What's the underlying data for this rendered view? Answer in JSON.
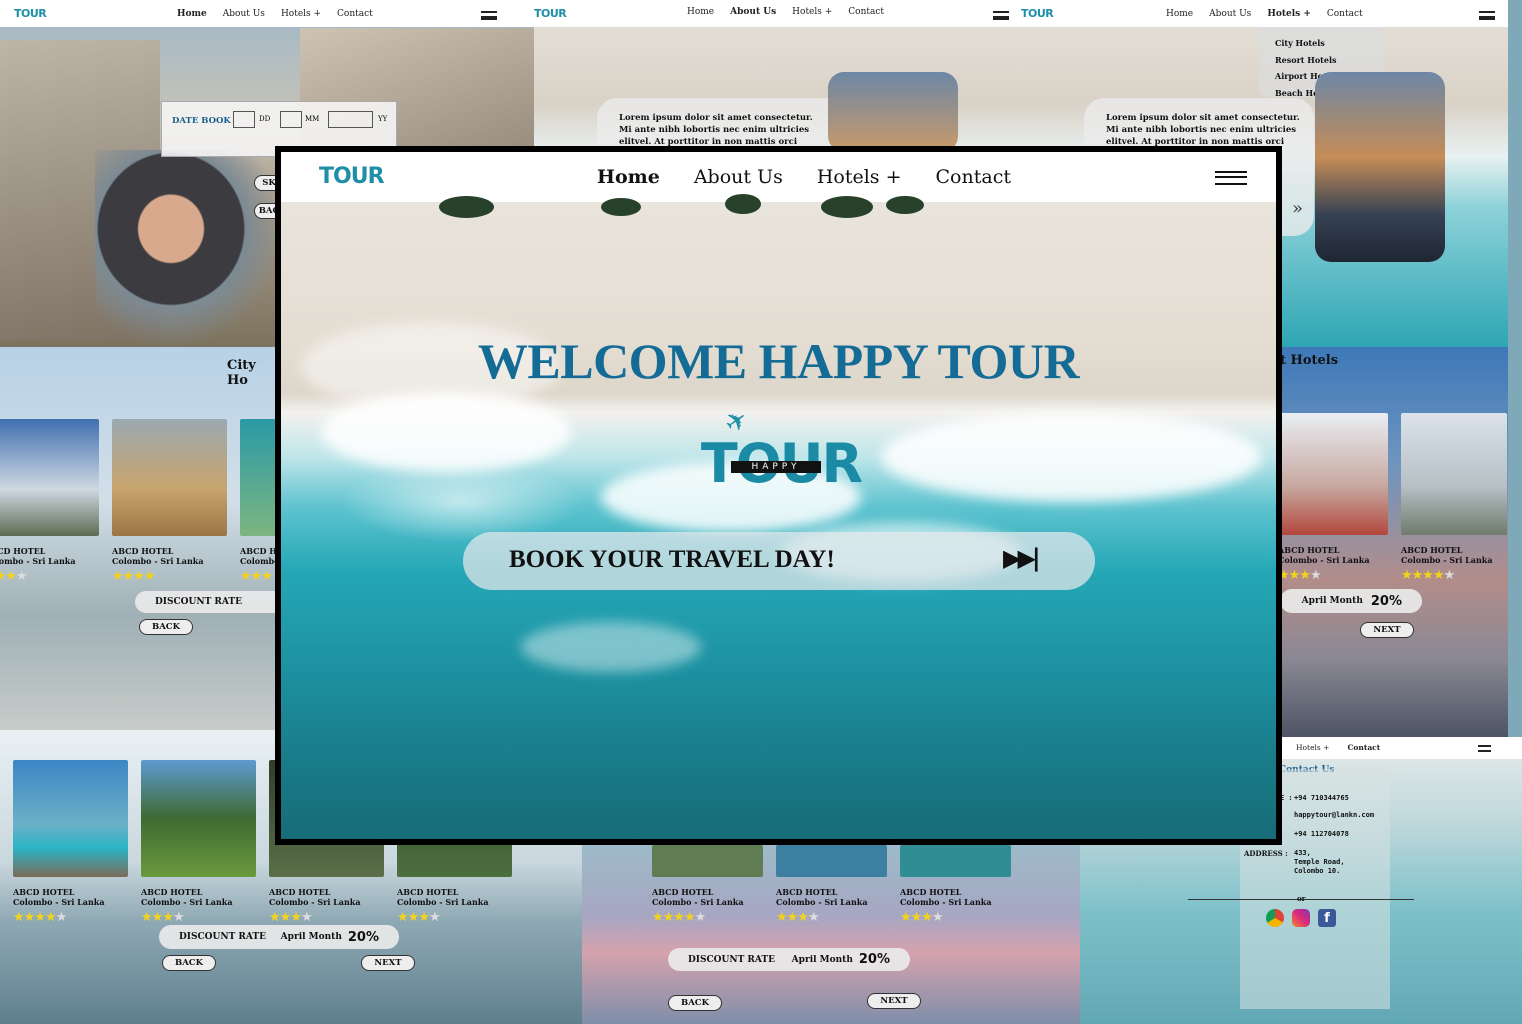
{
  "brand": {
    "logo_text": "TOUR",
    "logo_sub": "HAPPY"
  },
  "nav": {
    "home": "Home",
    "about": "About Us",
    "hotels": "Hotels +",
    "contact": "Contact"
  },
  "hero": {
    "headline": "WELCOME HAPPY TOUR",
    "cta": "BOOK YOUR TRAVEL DAY!",
    "cta_icon": "▶▶|"
  },
  "date_book": {
    "label": "DATE BOOK",
    "dd": "DD",
    "mm": "MM",
    "yy": "YY",
    "skip": "SK",
    "back": "BAC"
  },
  "about": {
    "text": [
      "Lorem ipsum dolor sit amet consectetur.",
      "Mi ante nibh lobortis nec enim ultricies",
      "elitvel. At porttitor in non mattis orci"
    ]
  },
  "hotels_menu": [
    "City Hotels",
    "Resort Hotels",
    "Airport Hotels",
    "Beach Hotels"
  ],
  "sections": {
    "city": "City Ho",
    "airport": "t Hotels",
    "contact_title": "Contact Us"
  },
  "hotel": {
    "name": "ABCD HOTEL",
    "location": "Colombo - Sri Lanka"
  },
  "promo": {
    "discount": "DISCOUNT RATE",
    "month": "April Month",
    "rate": "20%",
    "back": "BACK",
    "next": "NEXT"
  },
  "contact": {
    "phone": "+94 710344765",
    "email": "happytour@lankn.com",
    "phone2": "+94 112704078",
    "address_label": "ADDRESS :",
    "address": [
      "433,",
      "Temple Road,",
      "Colombo 10."
    ],
    "or": "or",
    "e_label": "E :"
  },
  "colors": {
    "accent": "#136b96",
    "brand": "#1e8fa6",
    "star": "#f3d31a"
  }
}
